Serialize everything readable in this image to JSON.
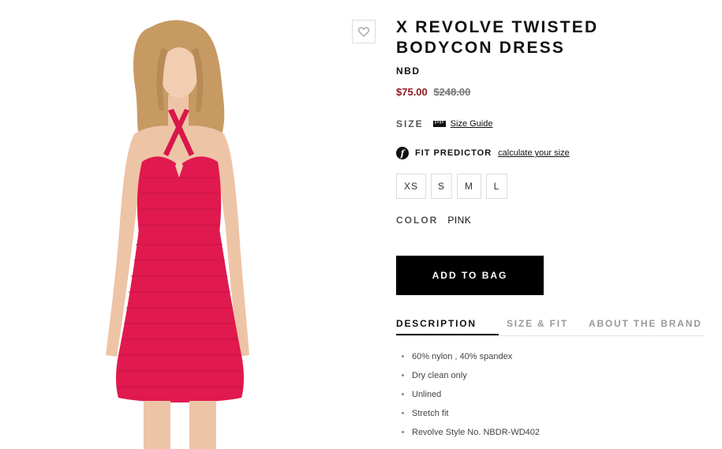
{
  "product": {
    "title": "X REVOLVE TWISTED BODYCON DRESS",
    "brand": "NBD",
    "price_sale": "$75.00",
    "price_original": "$248.00",
    "image_icon": "model-wearing-pink-dress-image"
  },
  "wishlist": {
    "icon": "heart-icon"
  },
  "size": {
    "label": "SIZE",
    "guide_icon": "ruler-icon",
    "guide_link": "Size Guide",
    "options": [
      "XS",
      "S",
      "M",
      "L"
    ]
  },
  "fit_predictor": {
    "icon": "fit-predictor-icon",
    "label": "FIT PREDICTOR",
    "link": "calculate your size"
  },
  "color": {
    "label": "COLOR",
    "value": "PINK"
  },
  "add_to_bag": "ADD TO BAG",
  "tabs": [
    "DESCRIPTION",
    "SIZE & FIT",
    "ABOUT THE BRAND"
  ],
  "description": [
    "60% nylon , 40% spandex",
    "Dry clean only",
    "Unlined",
    "Stretch fit",
    "Revolve Style No. NBDR-WD402"
  ],
  "colors": {
    "sale_price": "#8e1b23",
    "dress": "#e0194f",
    "button": "#000000"
  }
}
